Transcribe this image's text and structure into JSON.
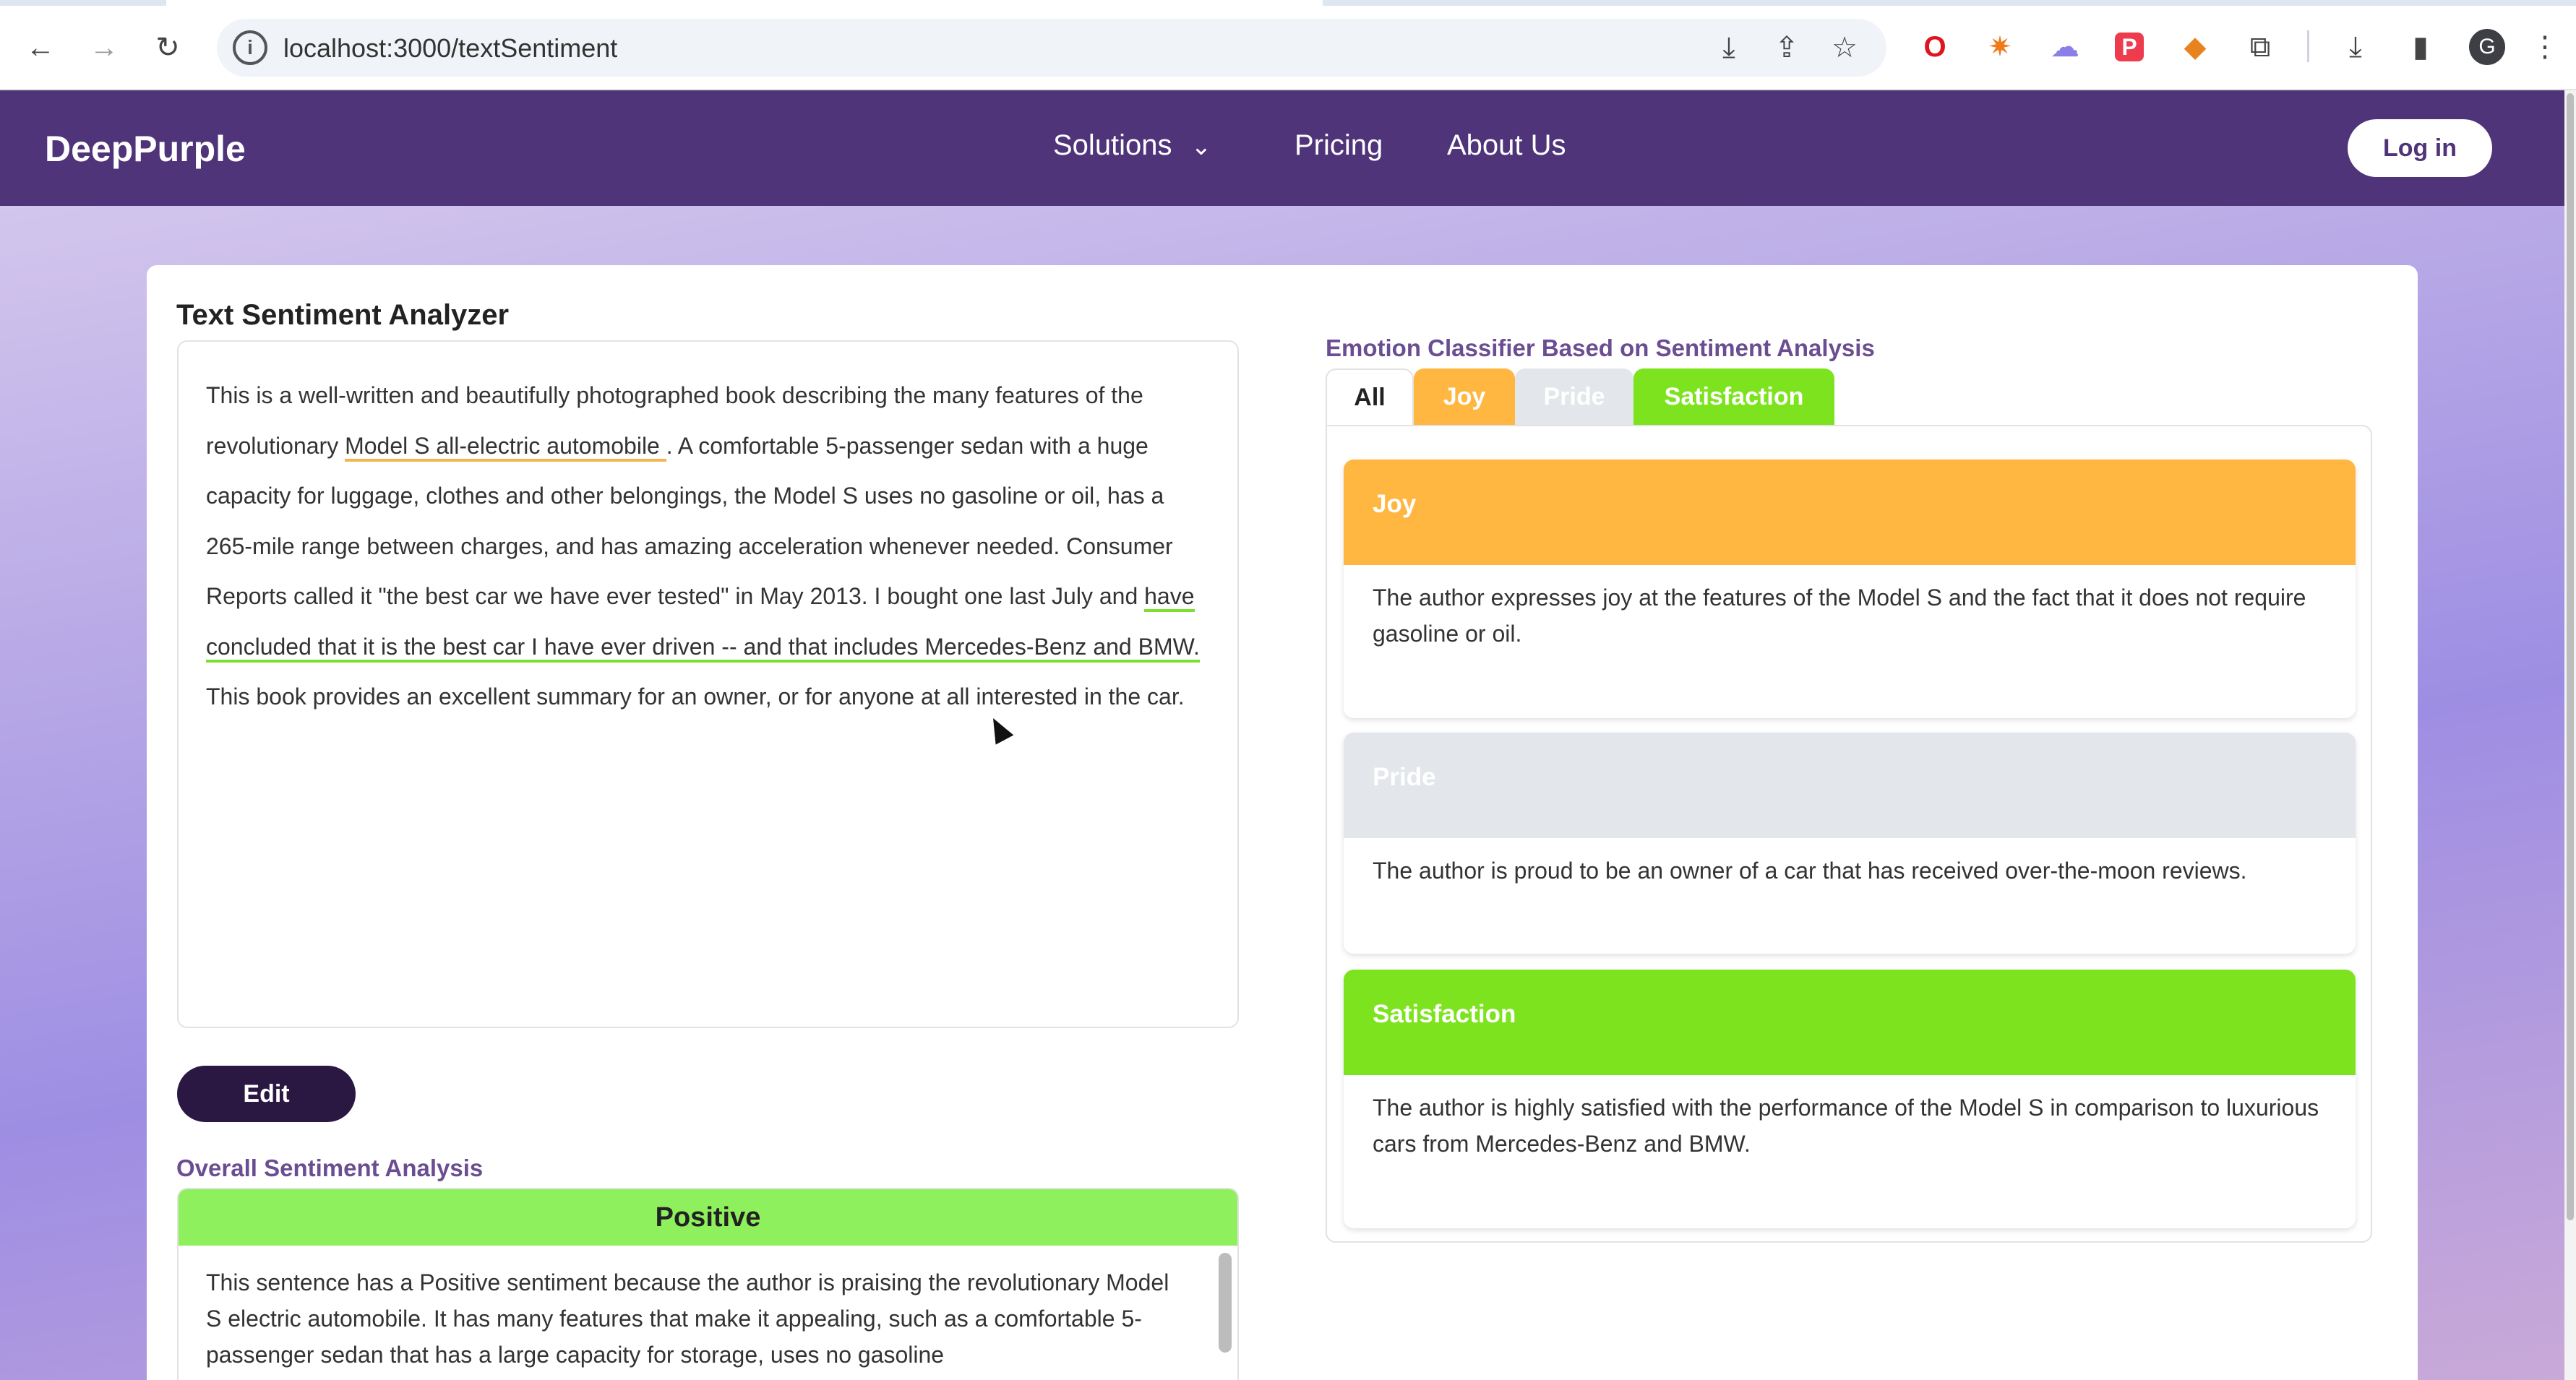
{
  "browser": {
    "url": "localhost:3000/textSentiment",
    "avatar_letter": "G"
  },
  "nav": {
    "brand": "DeepPurple",
    "links": [
      "Solutions",
      "Pricing",
      "About Us"
    ],
    "login": "Log in"
  },
  "analyzer": {
    "title": "Text Sentiment Analyzer",
    "text_parts": [
      "This is a well-written and beautifully photographed book describing the many features of the revolutionary ",
      "Model S all-electric automobile ",
      ". A comfortable 5-passenger sedan with a huge capacity for luggage, clothes and other belongings, the Model S uses no gasoline or oil, has a 265-mile range between charges, and has amazing acceleration whenever needed. Consumer Reports called it \"the best car we have ever tested\" in May 2013. I bought one last July and ",
      "have concluded that it is the best car I have ever driven -- and that includes Mercedes-Benz and BMW.",
      " This book provides an excellent summary for an owner, or for anyone at all interested in the car."
    ],
    "edit_label": "Edit"
  },
  "overall": {
    "title": "Overall Sentiment Analysis",
    "sentiment": "Positive",
    "explanation": "This sentence has a Positive sentiment because the author is praising the revolutionary Model S electric automobile. It has many features that make it appealing, such as a comfortable 5-passenger sedan that has a large capacity for storage, uses no gasoline"
  },
  "emotion": {
    "title": "Emotion Classifier Based on Sentiment Analysis",
    "tabs": [
      "All",
      "Joy",
      "Pride",
      "Satisfaction"
    ],
    "cards": [
      {
        "name": "Joy",
        "text": "The author expresses joy at the features of the Model S and the fact that it does not require gasoline or oil.",
        "color": "#ffb742"
      },
      {
        "name": "Pride",
        "text": "The author is proud to be an owner of a car that has received over-the-moon reviews.",
        "color": "#e3e6ea"
      },
      {
        "name": "Satisfaction",
        "text": "The author is highly satisfied with the performance of the Model S in comparison to luxurious cars from Mercedes-Benz and BMW.",
        "color": "#7ee31f"
      }
    ]
  },
  "colors": {
    "nav_bg": "#503479",
    "joy": "#ffb742",
    "pride": "#e3e6ea",
    "satisfaction": "#7ee31f",
    "positive": "#8ef05c",
    "edit_button": "#2a1842"
  },
  "icons": {
    "back": "back-arrow-icon",
    "forward": "forward-arrow-icon",
    "reload": "reload-icon",
    "site_info": "site-info-icon",
    "install": "install-app-icon",
    "share": "share-icon",
    "bookmark": "bookmark-star-icon",
    "extensions": "puzzle-icon",
    "downloads": "download-icon",
    "sidepanel": "side-panel-icon",
    "menu": "kebab-menu-icon",
    "cursor": "mouse-cursor-icon"
  }
}
